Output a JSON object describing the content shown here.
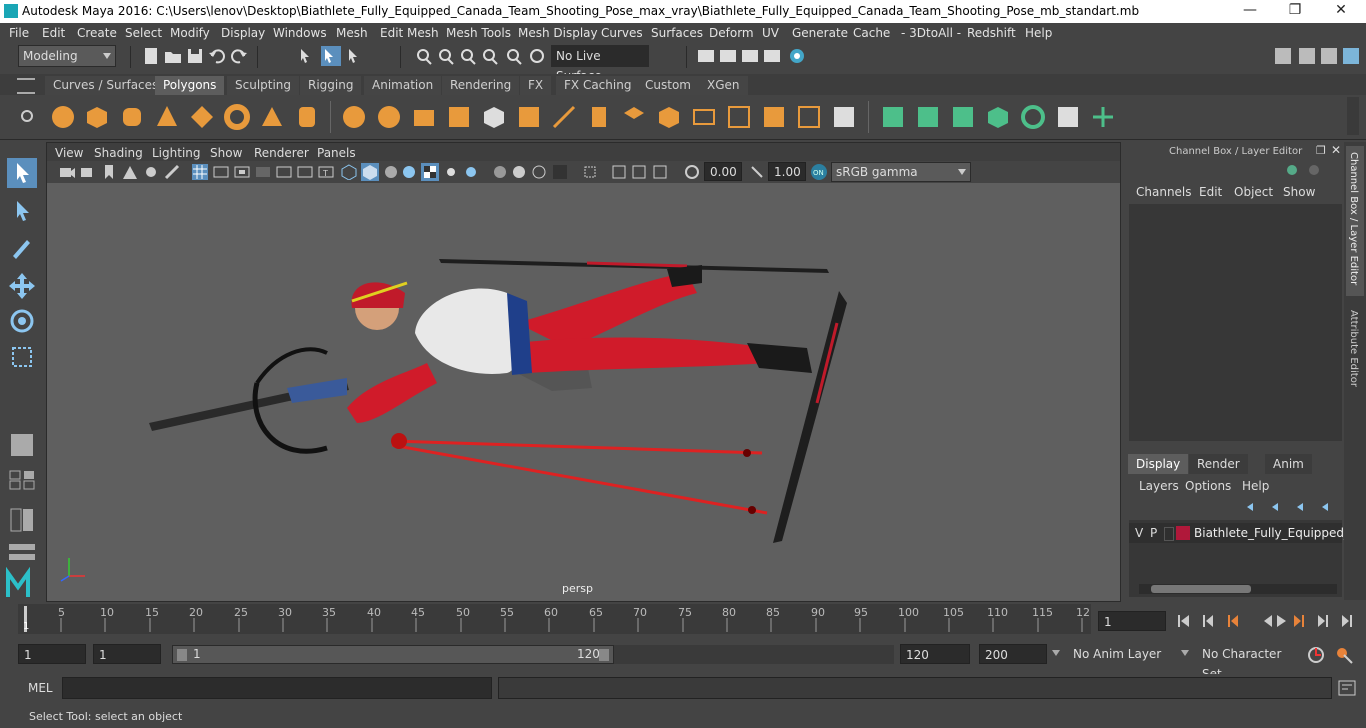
{
  "window": {
    "title": "Autodesk Maya 2016: C:\\Users\\lenov\\Desktop\\Biathlete_Fully_Equipped_Canada_Team_Shooting_Pose_max_vray\\Biathlete_Fully_Equipped_Canada_Team_Shooting_Pose_mb_standart.mb"
  },
  "menu": [
    "File",
    "Edit",
    "Create",
    "Select",
    "Modify",
    "Display",
    "Windows",
    "Mesh",
    "Edit Mesh",
    "Mesh Tools",
    "Mesh Display",
    "Curves",
    "Surfaces",
    "Deform",
    "UV",
    "Generate",
    "Cache",
    "- 3DtoAll -",
    "Redshift",
    "Help"
  ],
  "status": {
    "mode": "Modeling",
    "live_surface": "No Live Surface"
  },
  "shelf_tabs": [
    "Curves / Surfaces",
    "Polygons",
    "Sculpting",
    "Rigging",
    "Animation",
    "Rendering",
    "FX",
    "FX Caching",
    "Custom",
    "XGen"
  ],
  "active_shelf_tab": "Polygons",
  "viewport": {
    "menu": [
      "View",
      "Shading",
      "Lighting",
      "Show",
      "Renderer",
      "Panels"
    ],
    "exposure": "0.00",
    "gamma": "1.00",
    "colorspace": "sRGB gamma",
    "camera": "persp"
  },
  "channel_box": {
    "title": "Channel Box / Layer Editor",
    "menu": [
      "Channels",
      "Edit",
      "Object",
      "Show"
    ],
    "layer_tabs": [
      "Display",
      "Render",
      "Anim"
    ],
    "layer_menu": [
      "Layers",
      "Options",
      "Help"
    ],
    "layer_row": {
      "v": "V",
      "p": "P",
      "name": "Biathlete_Fully_Equipped_Ca",
      "color": "#b0183a"
    }
  },
  "side_tabs": [
    "Channel Box / Layer Editor",
    "Attribute Editor"
  ],
  "timeline": {
    "ticks": [
      "5",
      "10",
      "15",
      "20",
      "25",
      "30",
      "35",
      "40",
      "45",
      "50",
      "55",
      "60",
      "65",
      "70",
      "75",
      "80",
      "85",
      "90",
      "95",
      "100",
      "105",
      "110",
      "115",
      "12"
    ],
    "start_marker": "1",
    "current_frame": "1"
  },
  "range": {
    "start": "1",
    "start2": "1",
    "slider_start": "1",
    "slider_end": "120",
    "end": "120",
    "end2": "200",
    "anim_layer": "No Anim Layer",
    "character_set": "No Character Set"
  },
  "cmdline": {
    "label": "MEL"
  },
  "helpline": "Select Tool: select an object"
}
